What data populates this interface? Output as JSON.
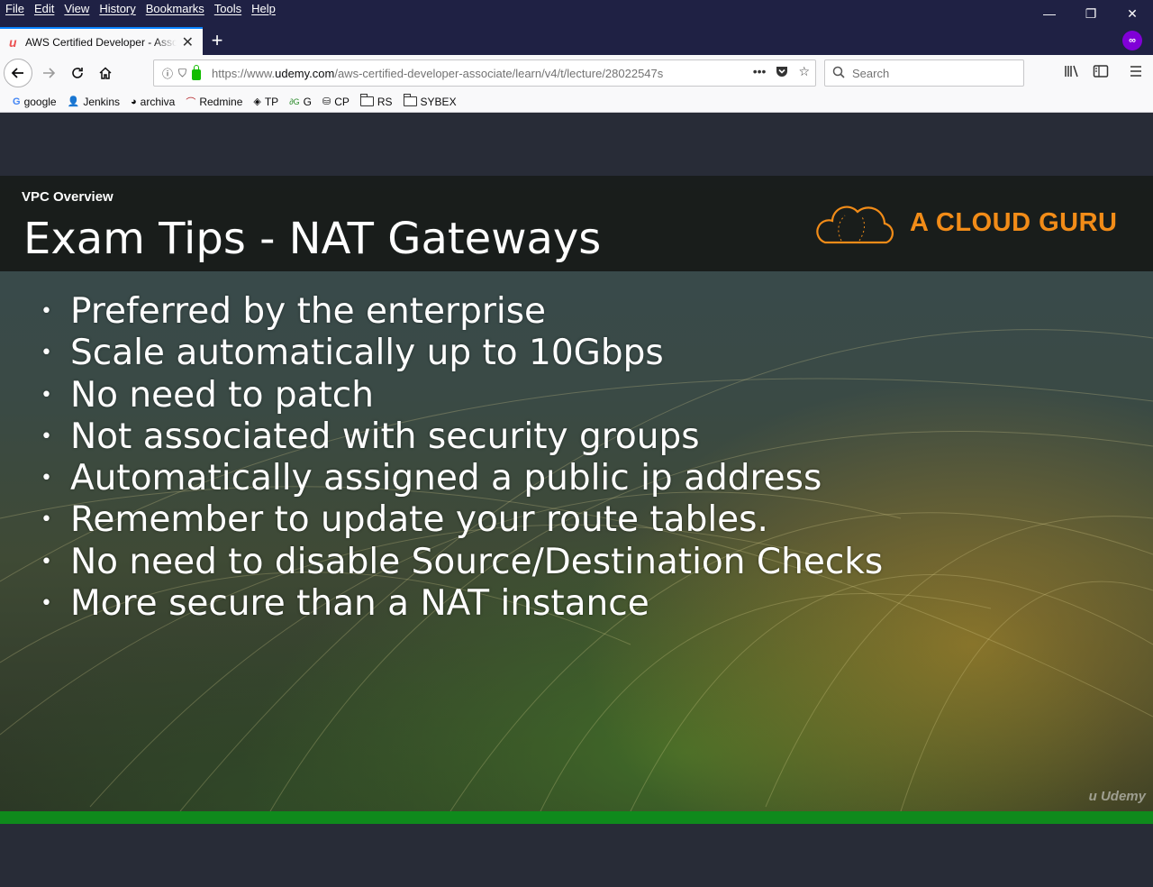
{
  "menubar": {
    "items": [
      {
        "label": "File"
      },
      {
        "label": "Edit"
      },
      {
        "label": "View"
      },
      {
        "label": "History"
      },
      {
        "label": "Bookmarks"
      },
      {
        "label": "Tools"
      },
      {
        "label": "Help"
      }
    ],
    "window_controls": {
      "minimize": "—",
      "restore": "❐",
      "close": "✕"
    }
  },
  "tabs": [
    {
      "title": "AWS Certified Developer - Associate",
      "favicon": "udemy-icon",
      "close": "✕"
    }
  ],
  "newtab_label": "+",
  "navbar": {
    "url_prefix": "https://www.",
    "url_domain": "udemy.com",
    "url_path": "/aws-certified-developer-associate/learn/v4/t/lecture/28022547s",
    "url_more": "•••",
    "search_placeholder": "Search"
  },
  "bookmarks": [
    {
      "label": "google",
      "icon": "google-icon"
    },
    {
      "label": "Jenkins",
      "icon": "jenkins-icon"
    },
    {
      "label": "archiva",
      "icon": "archiva-icon"
    },
    {
      "label": "Redmine",
      "icon": "redmine-icon"
    },
    {
      "label": "TP",
      "icon": "tp-icon"
    },
    {
      "label": "G",
      "icon": "g-icon"
    },
    {
      "label": "CP",
      "icon": "cp-icon"
    },
    {
      "label": "RS",
      "icon": "folder-icon"
    },
    {
      "label": "SYBEX",
      "icon": "folder-icon"
    }
  ],
  "slide": {
    "section": "VPC Overview",
    "title": "Exam Tips - NAT Gateways",
    "brand": "A CLOUD GURU",
    "bullets": [
      "Preferred by the enterprise",
      "Scale automatically up to 10Gbps",
      "No need to patch",
      "Not associated with security groups",
      "Automatically assigned a public ip address",
      "Remember to update your route tables.",
      "No need to disable Source/Destination Checks",
      "More secure than a NAT instance"
    ],
    "watermark": "Udemy"
  },
  "video": {
    "progress_fraction": 1.0
  },
  "colors": {
    "accent_tab": "#0a84ff",
    "brand_orange": "#f28c18",
    "progress_green": "#0f8a1c",
    "private_purple": "#8000d7"
  }
}
